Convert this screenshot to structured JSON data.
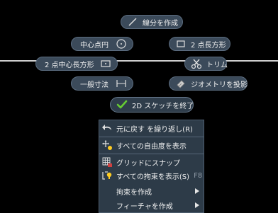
{
  "marking_menu": {
    "line_segment": "線分を作成",
    "center_circle": "中心点円",
    "two_point_rect": "2 点長方形",
    "two_point_center_rect": "2 点中心長方形",
    "trim": "トリム",
    "dimension": "一般寸法",
    "project_geometry": "ジオメトリを投影",
    "finish_sketch": "2D スケッチを終了"
  },
  "context_menu": {
    "items": [
      {
        "label": "元に戻す を繰り返し(R)",
        "icon": "undo-arrow-icon"
      },
      {
        "label": "すべての自由度を表示",
        "icon": "dof-icon"
      },
      {
        "label": "グリッドにスナップ",
        "icon": "grid-snap-icon"
      },
      {
        "label": "すべての拘束を表示(S)",
        "shortcut": "F8",
        "icon": "constraint-icon"
      },
      {
        "label": "拘束を作成",
        "icon": "",
        "submenu": true
      },
      {
        "label": "フィーチャを作成",
        "icon": "",
        "submenu": true
      }
    ]
  },
  "colors": {
    "background": "#000000",
    "pill_bg": "#3b4a5a",
    "menu_bg": "#2d3b48",
    "check_green": "#66cc33"
  }
}
